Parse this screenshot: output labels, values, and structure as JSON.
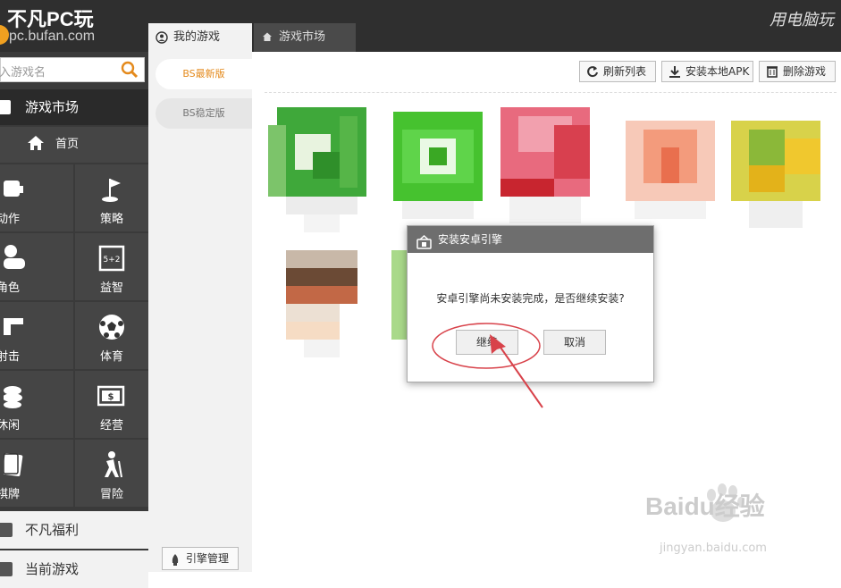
{
  "app": {
    "logo_title_a": "不凡",
    "logo_title_b": "PC",
    "logo_title_c": "玩",
    "logo_url": "pc.bufan.com",
    "top_right_slogan": "用电脑玩"
  },
  "tabs": [
    {
      "label": "我的游戏",
      "icon": "user-circle-icon",
      "active": true
    },
    {
      "label": "游戏市场",
      "icon": "home-icon",
      "active": false
    }
  ],
  "sidebar": {
    "search_placeholder": "入游戏名",
    "category_header": "游戏市场",
    "home_label": "首页",
    "categories": [
      {
        "label": "动作",
        "icon": "action-icon"
      },
      {
        "label": "策略",
        "icon": "flag-icon"
      },
      {
        "label": "角色",
        "icon": "role-icon"
      },
      {
        "label": "益智",
        "icon": "puzzle-icon"
      },
      {
        "label": "射击",
        "icon": "gun-icon"
      },
      {
        "label": "体育",
        "icon": "soccer-icon"
      },
      {
        "label": "休闲",
        "icon": "leisure-icon"
      },
      {
        "label": "经营",
        "icon": "money-icon"
      },
      {
        "label": "棋牌",
        "icon": "cards-icon"
      },
      {
        "label": "冒险",
        "icon": "hiker-icon"
      }
    ],
    "welfare_label": "不凡福利",
    "current_games_label": "当前游戏"
  },
  "subnav": {
    "items": [
      "BS最新版",
      "BS稳定版"
    ],
    "engine_button": "引擎管理"
  },
  "toolbar": {
    "refresh": "刷新列表",
    "install_apk": "安装本地APK",
    "delete": "删除游戏"
  },
  "dialog": {
    "title": "安装安卓引擎",
    "message": "安卓引擎尚未安装完成，是否继续安装?",
    "continue": "继续",
    "cancel": "取消"
  },
  "watermark": {
    "brand": "Baidu经验",
    "url": "jingyan.baidu.com"
  },
  "colors": {
    "topbar": "#2f2f2f",
    "sidebar": "#3a3a3a",
    "accent_orange": "#e48a1c",
    "annotation_red": "#d8424a"
  }
}
